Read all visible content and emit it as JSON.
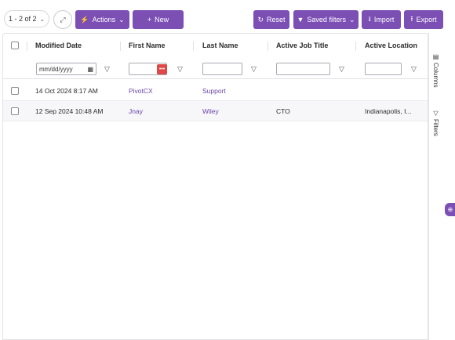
{
  "toolbar": {
    "pager_text": "1 - 2 of 2",
    "pager_icon": "chevron-down-icon",
    "expand_icon": "expand-icon",
    "actions_label": "Actions",
    "new_label": "New",
    "reset_label": "Reset",
    "saved_filters_label": "Saved filters",
    "import_label": "Import",
    "export_label": "Export"
  },
  "columns": [
    {
      "label": "Modified Date"
    },
    {
      "label": "First Name"
    },
    {
      "label": "Last Name"
    },
    {
      "label": "Active Job Title"
    },
    {
      "label": "Active Location"
    }
  ],
  "filters": {
    "date_placeholder": "mm/dd/yyyy"
  },
  "rows": [
    {
      "modified": "14 Oct 2024 8:17 AM",
      "first": "PivotCX",
      "last": "Support",
      "title": "",
      "location": ""
    },
    {
      "modified": "12 Sep 2024 10:48 AM",
      "first": "Jnay",
      "last": "Wiley",
      "title": "CTO",
      "location": "Indianapolis, I..."
    }
  ],
  "side_panel": {
    "columns_label": "Columns",
    "filters_label": "Filters"
  },
  "colors": {
    "accent": "#7c4fb5",
    "link": "#6b45a8",
    "badge": "#e04848"
  }
}
